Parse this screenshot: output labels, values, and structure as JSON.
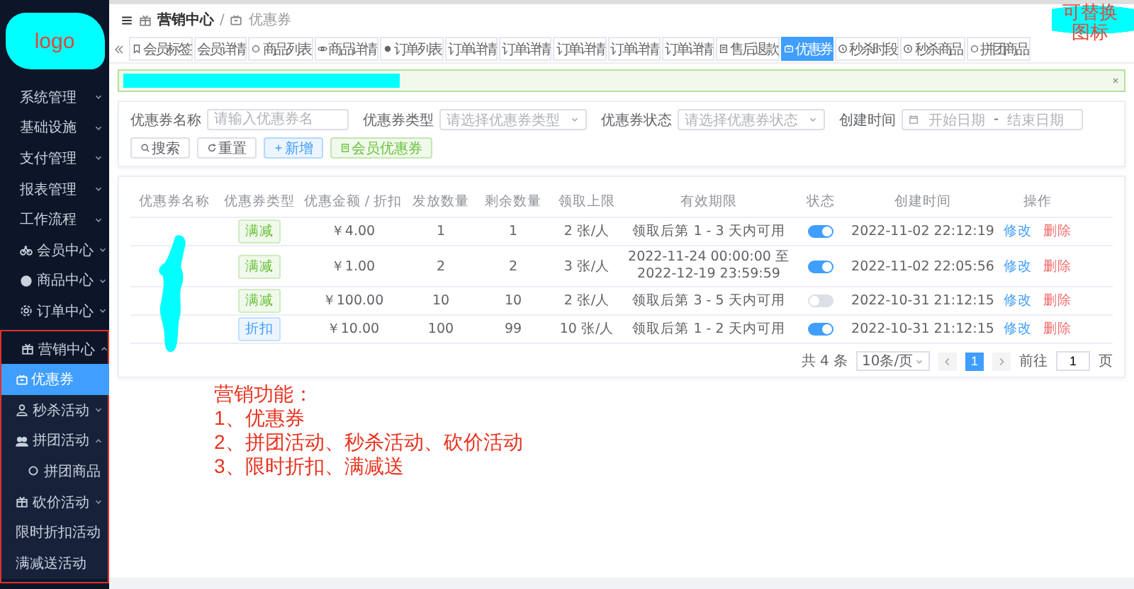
{
  "sidebar": {
    "logo": "logo",
    "items": [
      {
        "label": "系统管理",
        "expanded": false,
        "selected": false
      },
      {
        "label": "基础设施",
        "expanded": false,
        "selected": false
      },
      {
        "label": "支付管理",
        "expanded": false,
        "selected": false
      },
      {
        "label": "报表管理",
        "expanded": false,
        "selected": false
      },
      {
        "label": "工作流程",
        "expanded": false,
        "selected": false
      },
      {
        "label": "会员中心",
        "expanded": false,
        "selected": false
      },
      {
        "label": "商品中心",
        "expanded": false,
        "selected": false
      },
      {
        "label": "订单中心",
        "expanded": false,
        "selected": false
      },
      {
        "label": "营销中心",
        "expanded": true,
        "selected": false,
        "children": [
          {
            "label": "优惠券",
            "selected": true
          },
          {
            "label": "秒杀活动",
            "expanded": false,
            "selected": false
          },
          {
            "label": "拼团活动",
            "expanded": true,
            "selected": false,
            "children": [
              {
                "label": "拼团商品",
                "selected": false
              }
            ]
          },
          {
            "label": "砍价活动",
            "expanded": false,
            "selected": false
          },
          {
            "label": "限时折扣活动",
            "selected": false
          },
          {
            "label": "满减送活动",
            "selected": false
          }
        ]
      }
    ]
  },
  "breadcrumb": [
    "营销中心",
    "/",
    "优惠券"
  ],
  "tabs": [
    {
      "label": "会员标签",
      "selected": false
    },
    {
      "label": "会员详情",
      "selected": false
    },
    {
      "label": "商品列表",
      "selected": false
    },
    {
      "label": "商品详情",
      "selected": false
    },
    {
      "label": "订单列表",
      "selected": false
    },
    {
      "label": "订单详情",
      "selected": false
    },
    {
      "label": "订单详情",
      "selected": false
    },
    {
      "label": "订单详情",
      "selected": false
    },
    {
      "label": "订单详情",
      "selected": false
    },
    {
      "label": "订单详情",
      "selected": false
    },
    {
      "label": "售后退款",
      "selected": false
    },
    {
      "label": "优惠券",
      "selected": true
    },
    {
      "label": "秒杀时段",
      "selected": false
    },
    {
      "label": "秒杀商品",
      "selected": false
    },
    {
      "label": "拼团商品",
      "selected": false
    }
  ],
  "filters": [
    {
      "kind": "input",
      "label": "优惠券名称",
      "placeholder": "请输入优惠券名"
    },
    {
      "kind": "select",
      "label": "优惠券类型",
      "placeholder": "请选择优惠券类型"
    },
    {
      "kind": "select",
      "label": "优惠券状态",
      "placeholder": "请选择优惠券状态"
    },
    {
      "kind": "daterange",
      "label": "创建时间",
      "start_placeholder": "开始日期",
      "separator": "-",
      "end_placeholder": "结束日期"
    }
  ],
  "buttons": [
    {
      "kind": "search",
      "label": "搜索"
    },
    {
      "kind": "reset",
      "label": "重置"
    },
    {
      "kind": "add",
      "label": "新增"
    },
    {
      "kind": "member",
      "label": "会员优惠券"
    }
  ],
  "table": {
    "columns": [
      "优惠券名称",
      "优惠券类型",
      "优惠金额 / 折扣",
      "发放数量",
      "剩余数量",
      "领取上限",
      "有效期限",
      "状态",
      "创建时间",
      "操作"
    ],
    "rows": [
      {
        "type": "满减",
        "color": "#67c23a",
        "amount": "￥4.00",
        "issued": "1",
        "remaining": "1",
        "limit": "2 张/人",
        "validity": [
          "领取后第 1 - 3 天内可用"
        ],
        "on": true,
        "created": "2022-11-02 22:12:19",
        "actions": [
          "修改",
          "删除"
        ]
      },
      {
        "type": "满减",
        "color": "#67c23a",
        "amount": "￥1.00",
        "issued": "2",
        "remaining": "2",
        "limit": "3 张/人",
        "validity": [
          "2022-11-24 00:00:00 至",
          "2022-12-19 23:59:59"
        ],
        "on": true,
        "created": "2022-11-02 22:05:56",
        "actions": [
          "修改",
          "删除"
        ]
      },
      {
        "type": "满减",
        "color": "#67c23a",
        "amount": "￥100.00",
        "issued": "10",
        "remaining": "10",
        "limit": "2 张/人",
        "validity": [
          "领取后第 3 - 5 天内可用"
        ],
        "on": false,
        "created": "2022-10-31 21:12:15",
        "actions": [
          "修改",
          "删除"
        ]
      },
      {
        "type": "折扣",
        "color": "#409eff",
        "amount": "￥10.00",
        "issued": "100",
        "remaining": "99",
        "limit": "10 张/人",
        "validity": [
          "领取后第 1 - 2 天内可用"
        ],
        "on": true,
        "created": "2022-10-31 21:12:15",
        "actions": [
          "修改",
          "删除"
        ]
      }
    ]
  },
  "pagination": {
    "total": "共 4 条",
    "page_size": "10条/页",
    "pages": [
      {
        "label": "1",
        "selected": true
      }
    ],
    "goto_label": "前往",
    "goto_value": "1",
    "goto_suffix": "页"
  },
  "annotations": {
    "corner_note": "可替换图标",
    "notes": [
      "营销功能：",
      "1、优惠券",
      "2、拼团活动、秒杀活动、砍价活动",
      "3、限时折扣、满减送"
    ]
  }
}
